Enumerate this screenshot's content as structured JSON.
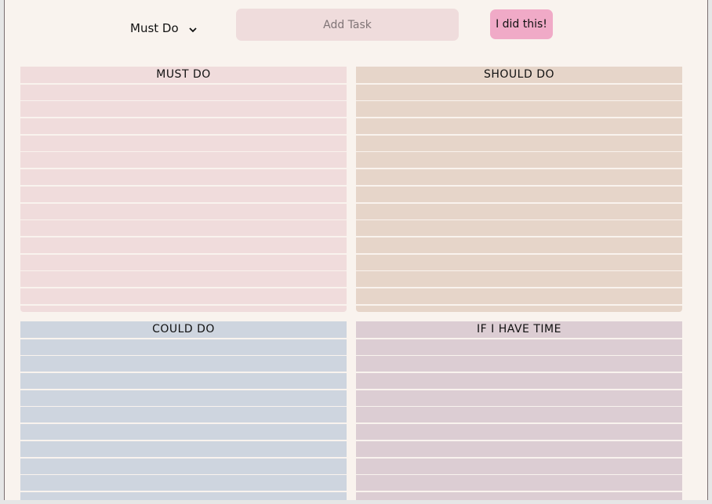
{
  "toolbar": {
    "category_select": "Must Do",
    "add_task_placeholder": "Add Task",
    "done_button": "I did this!"
  },
  "quadrants": {
    "must": {
      "title": "MUST DO"
    },
    "should": {
      "title": "SHOULD DO"
    },
    "could": {
      "title": "COULD DO"
    },
    "time": {
      "title": "IF I HAVE TIME"
    }
  },
  "colors": {
    "page_bg": "#f9f3ee",
    "must_bg": "#f0dcdc",
    "should_bg": "#e6d5c9",
    "could_bg": "#ced5df",
    "time_bg": "#dccdd3",
    "button_bg": "#f0aac7",
    "input_bg": "#efdcdc"
  },
  "icons": {
    "select": "chevron-down-icon"
  }
}
